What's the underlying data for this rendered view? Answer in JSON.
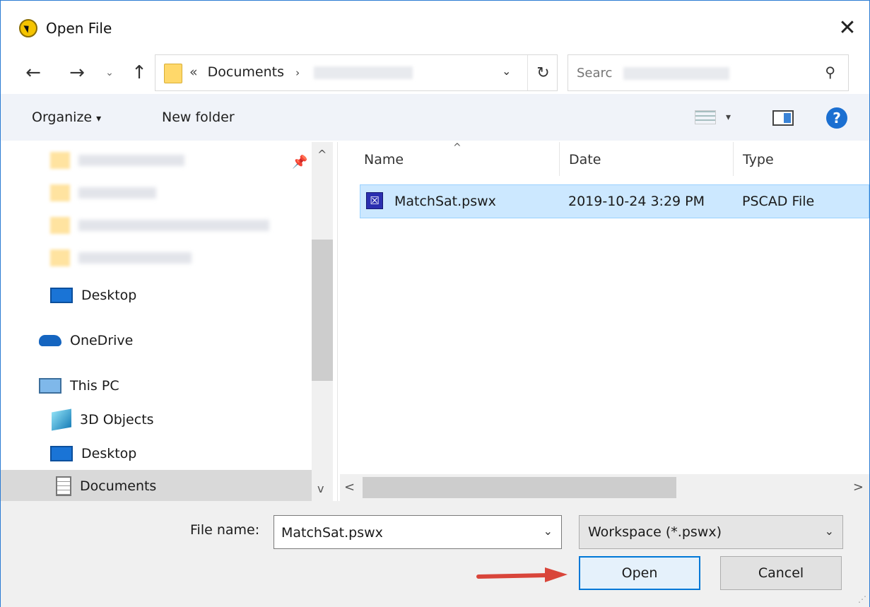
{
  "window": {
    "title": "Open File",
    "close_label": "✕"
  },
  "nav": {
    "back_label": "←",
    "forward_label": "→",
    "recent_label": "⌄",
    "up_label": "↑",
    "address_prefix": "«",
    "address_crumb": "Documents",
    "address_sep": "›",
    "address_dropdown": "⌄",
    "refresh_label": "↻",
    "search_placeholder": "Searc",
    "search_icon": "⚲"
  },
  "toolbar": {
    "organize_label": "Organize",
    "organize_caret": "▾",
    "new_folder_label": "New folder",
    "view_caret": "▾",
    "help_label": "?"
  },
  "sidebar": {
    "pin_icon": "📌",
    "items": [
      {
        "label": "Desktop",
        "icon": "desktop-icon"
      },
      {
        "label": "OneDrive",
        "icon": "onedrive-icon"
      },
      {
        "label": "This PC",
        "icon": "this-pc-icon"
      },
      {
        "label": "3D Objects",
        "icon": "3d-objects-icon"
      },
      {
        "label": "Desktop",
        "icon": "desktop-icon"
      },
      {
        "label": "Documents",
        "icon": "documents-icon"
      }
    ]
  },
  "file_list": {
    "sort_indicator": "^",
    "columns": [
      "Name",
      "Date",
      "Type"
    ],
    "rows": [
      {
        "name": "MatchSat.pswx",
        "date": "2019-10-24 3:29 PM",
        "type": "PSCAD File",
        "icon_glyph": "☒"
      }
    ]
  },
  "scroll": {
    "up": "^",
    "down": "v",
    "left": "<",
    "right": ">"
  },
  "footer": {
    "file_name_label": "File name:",
    "file_name_value": "MatchSat.pswx",
    "file_name_dropdown": "⌄",
    "file_type_value": "Workspace (*.pswx)",
    "file_type_dropdown": "⌄",
    "open_label": "Open",
    "cancel_label": "Cancel"
  },
  "colors": {
    "accent": "#0078d7",
    "selection": "#cce8ff",
    "toolbar_bg": "#f0f3f9",
    "annotation_arrow": "#d9453a"
  }
}
